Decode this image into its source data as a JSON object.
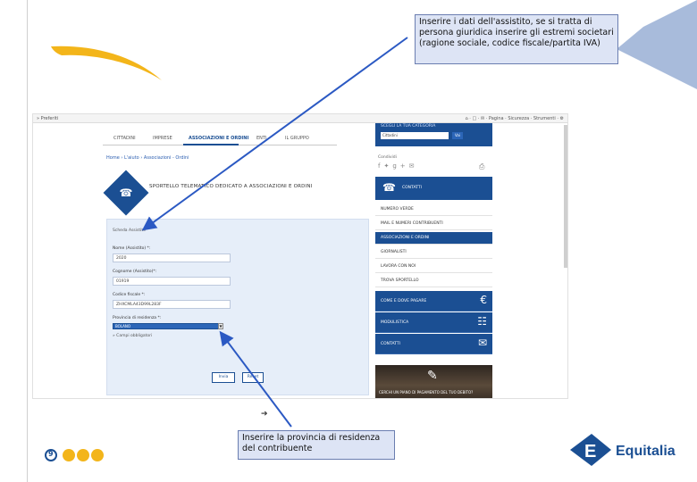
{
  "callouts": {
    "top_text": "Inserire i dati dell'assistito, se si tratta di persona giuridica inserire gli estremi societari (ragione sociale, codice fiscale/partita IVA)",
    "bottom_text": "Inserire la provincia di residenza del contribuente"
  },
  "slide": {
    "page_number": "9",
    "brand_name": "Equitalia"
  },
  "browser": {
    "toolbar_left": "»  Preferiti",
    "toolbar_right": "⌂ · □ · ✉ · Pagina · Sicurezza · Strumenti · ⚙"
  },
  "site": {
    "nav_tabs": [
      "CITTADINI",
      "IMPRESE",
      "ASSOCIAZIONI E ORDINI",
      "ENTI",
      "IL GRUPPO"
    ],
    "breadcrumb": "Home  ›  L'aiuto  ›  Associazioni - Ordini",
    "page_heading": "SPORTELLO TELEMATICO DEDICATO A ASSOCIAZIONI E ORDINI"
  },
  "form": {
    "section_title": "Scheda Assistito",
    "name_label": "Nome (Assistito) *:",
    "name_value": "2020",
    "surname_label": "Cognome (Assistito)*:",
    "surname_value": "01919",
    "tax_code_label": "Codice fiscale *:",
    "tax_code_value": "ZHXCMLA43D99L283F",
    "province_label": "Provincia di residenza *:",
    "province_value": "BOLANO",
    "extra_link": "»  Campi obbligatori",
    "submit_label": "Invia",
    "reset_label": "Reset"
  },
  "sidebar": {
    "top_title": "SCEGLI LA TUA CATEGORIA",
    "top_select": "Cittadini",
    "top_go": "Vai",
    "contacts_label": "Condividi",
    "social_icons": [
      "facebook-icon",
      "twitter-icon",
      "google-plus-icon",
      "email-icon"
    ],
    "header_label": "CONTATTI",
    "items": [
      "NUMERO VERDE",
      "MAIL E NUMERI CONTRIBUENTI",
      "ASSOCIAZIONI E ORDINI",
      "GIORNALISTI",
      "LAVORA CON NOI",
      "TROVA SPORTELLO"
    ],
    "active_item_index": 2,
    "blocks": [
      {
        "label": "COME E DOVE PAGARE",
        "icon": "euro-icon"
      },
      {
        "label": "MODULISTICA",
        "icon": "document-icon"
      },
      {
        "label": "CONTATTI",
        "icon": "mail-icon"
      }
    ],
    "promo_label": "CERCHI UN PIANO DI PAGAMENTO DEL TUO DEBITO?"
  },
  "colors": {
    "primary_blue": "#1b4f93",
    "accent_yellow": "#f3b51a",
    "callout_bg": "#dde4f5"
  }
}
